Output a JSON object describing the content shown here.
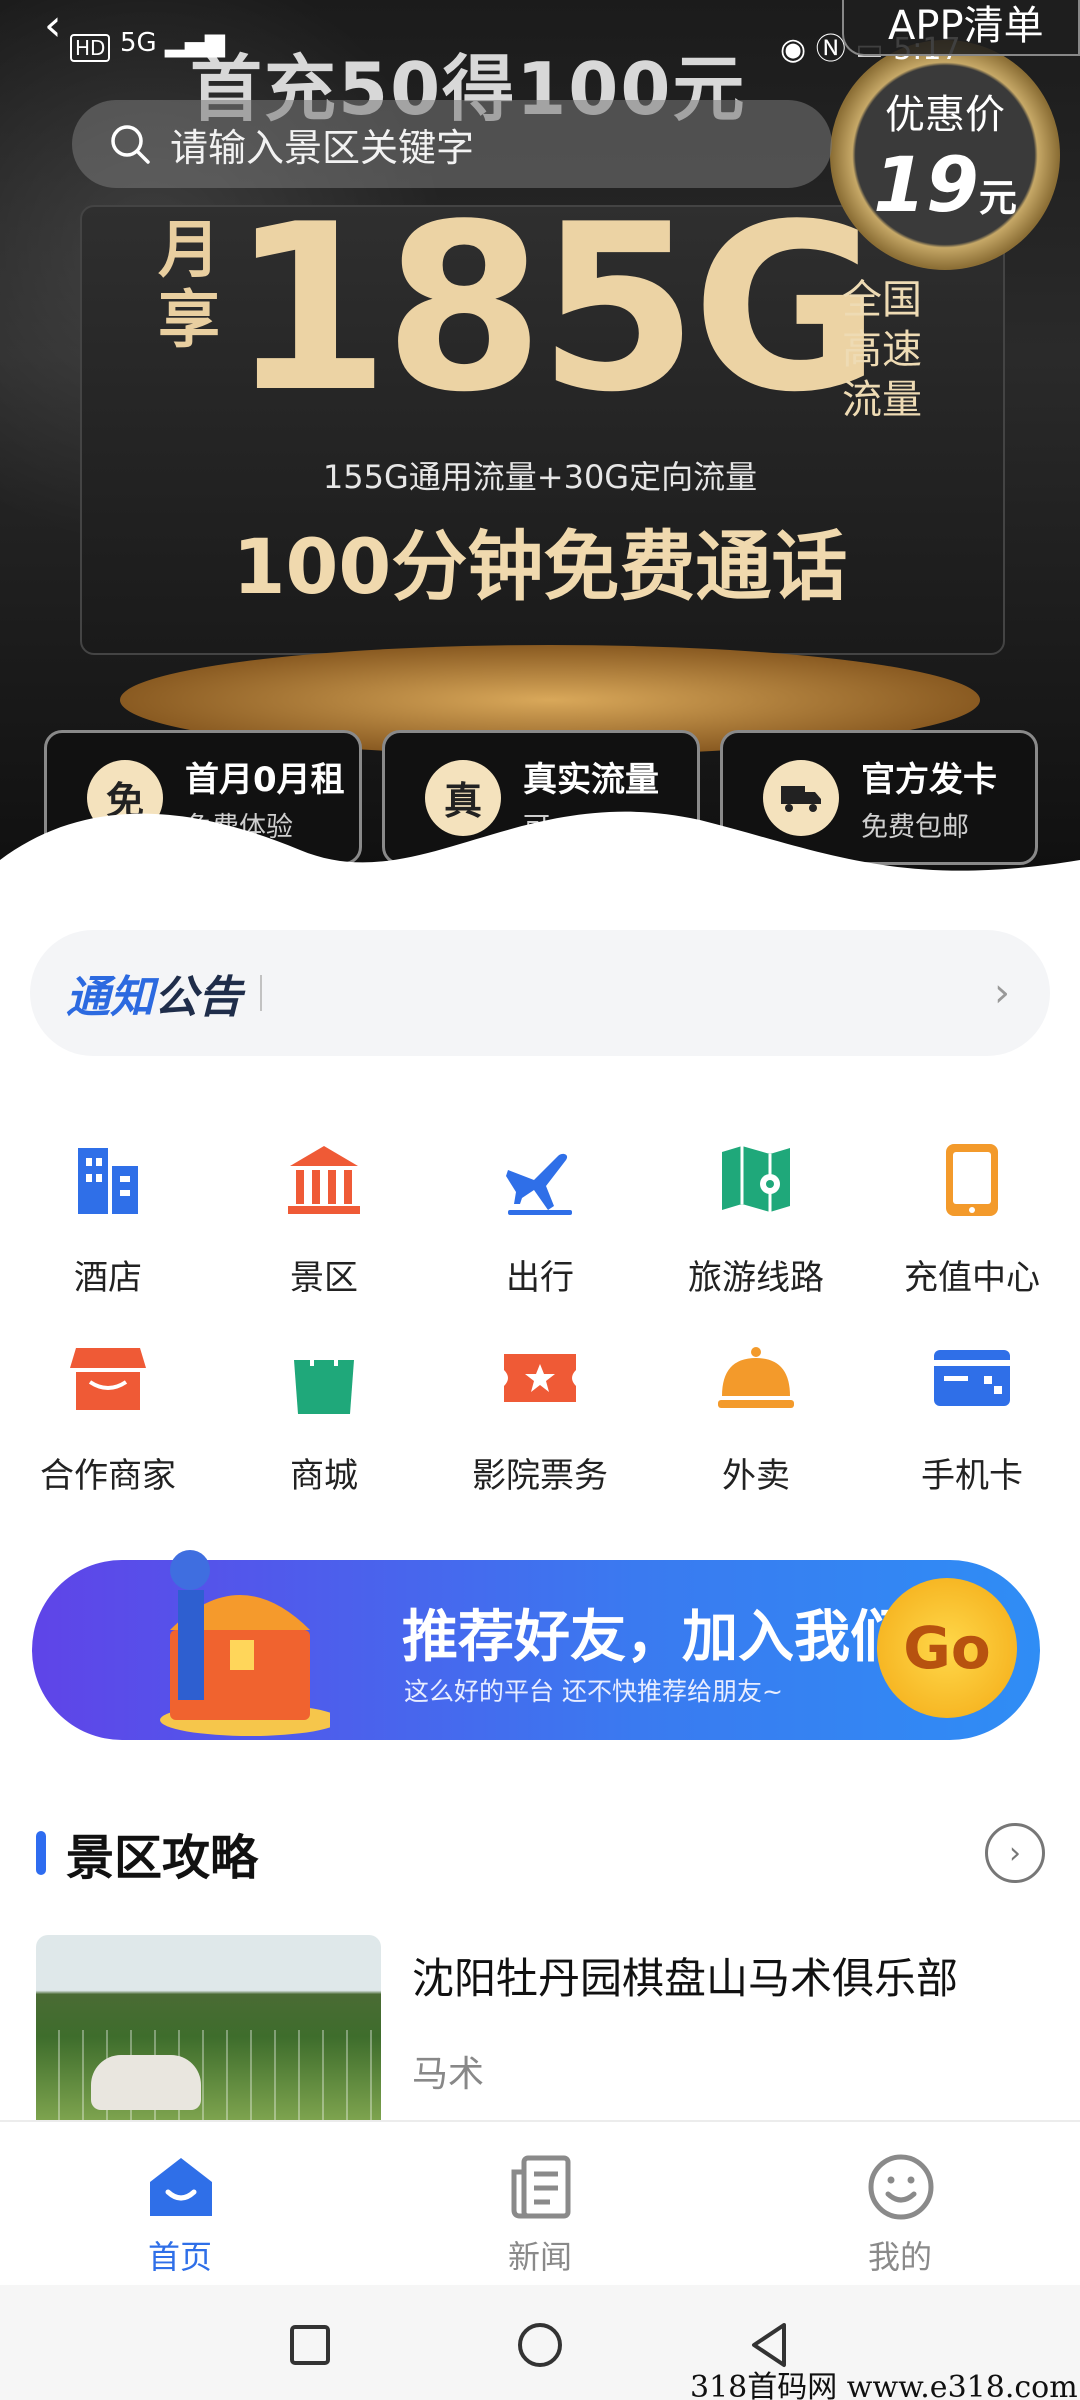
{
  "status_bar": {
    "back_glyph": "‹",
    "hd_label": "HD",
    "network": "5G",
    "time": "5:17"
  },
  "app_list_button": "APP清单",
  "banner": {
    "promo_top": "首充50得100元",
    "badge_line1": "优惠价",
    "badge_price": "19",
    "badge_unit": "元",
    "month_label": "月享",
    "data_amount": "185G",
    "side_label": "全国高速流量",
    "subtitle": "155G通用流量+30G定向流量",
    "minutes": "100分钟免费通话",
    "features": [
      {
        "icon_char": "免",
        "title": "首月0月租",
        "desc": "免费体验"
      },
      {
        "icon_char": "真",
        "title": "真实流量",
        "desc": "可"
      },
      {
        "icon_char": "",
        "title": "官方发卡",
        "desc": "免费包邮"
      }
    ]
  },
  "search": {
    "placeholder": "请输入景区关键字"
  },
  "notice": {
    "title_a": "通知",
    "title_b": "公告"
  },
  "services": [
    {
      "label": "酒店",
      "icon": "hotel-icon",
      "color": "#2f6fe8"
    },
    {
      "label": "景区",
      "icon": "scenic-icon",
      "color": "#ef5a36"
    },
    {
      "label": "出行",
      "icon": "travel-icon",
      "color": "#2f6fe8"
    },
    {
      "label": "旅游线路",
      "icon": "route-map-icon",
      "color": "#1fa87a"
    },
    {
      "label": "充值中心",
      "icon": "phone-recharge-icon",
      "color": "#f39a2b"
    },
    {
      "label": "合作商家",
      "icon": "merchant-icon",
      "color": "#ef5a36"
    },
    {
      "label": "商城",
      "icon": "shopping-bag-icon",
      "color": "#1fa87a"
    },
    {
      "label": "影院票务",
      "icon": "ticket-icon",
      "color": "#ef5a36"
    },
    {
      "label": "外卖",
      "icon": "takeout-icon",
      "color": "#f39a2b"
    },
    {
      "label": "手机卡",
      "icon": "sim-card-icon",
      "color": "#2f6fe8"
    }
  ],
  "invite": {
    "headline": "推荐好友，加入我们",
    "subline": "这么好的平台 还不快推荐给朋友~",
    "go": "Go"
  },
  "section": {
    "title": "景区攻略"
  },
  "article": {
    "title": "沈阳牡丹园棋盘山马术俱乐部",
    "tag": "马术"
  },
  "tabbar": [
    {
      "label": "首页",
      "active": true
    },
    {
      "label": "新闻",
      "active": false
    },
    {
      "label": "我的",
      "active": false
    }
  ],
  "watermark": "318首码网 www.e318.com",
  "colors": {
    "accent": "#2f6fe8",
    "banner_gold": "#ecd3a4"
  }
}
